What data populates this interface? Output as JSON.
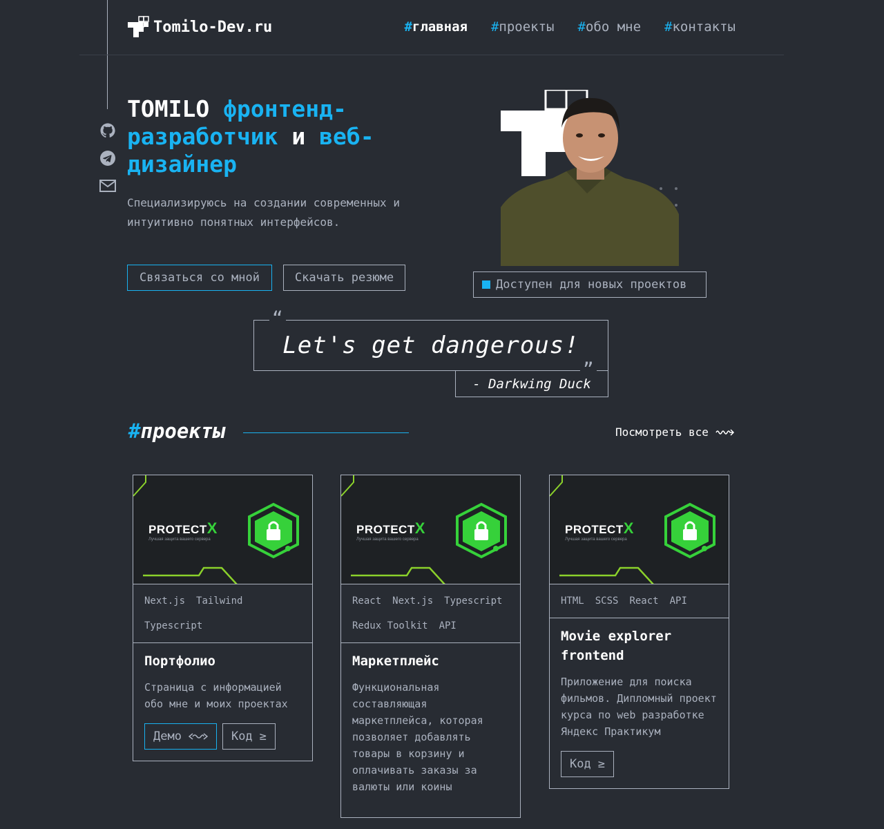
{
  "header": {
    "logo_text": "Tomilo-Dev.ru",
    "nav": [
      {
        "hash": "#",
        "label": "главная",
        "active": true
      },
      {
        "hash": "#",
        "label": "проекты",
        "active": false
      },
      {
        "hash": "#",
        "label": "обо мне",
        "active": false
      },
      {
        "hash": "#",
        "label": "контакты",
        "active": false
      }
    ]
  },
  "social": [
    "github-icon",
    "telegram-icon",
    "mail-icon"
  ],
  "hero": {
    "title_name": "TOMILO",
    "title_role1": "фронтенд-разработчик",
    "title_and": "и",
    "title_role2": "веб-дизайнер",
    "description": "Специализируюсь на создании современных и интуитивно понятных интерфейсов.",
    "contact_button": "Связаться со мной",
    "resume_button": "Скачать резюме",
    "status": "Доступен для новых проектов"
  },
  "quote": {
    "open_mark": "“",
    "close_mark": "”",
    "text": "Let's get dangerous!",
    "author": "- Darkwing Duck"
  },
  "projects": {
    "hash": "#",
    "title": "проекты",
    "view_all": "Посмотреть все",
    "items": [
      {
        "brand": "PROTECT",
        "brand_x": "X",
        "brand_sub": "Лучшая защита вашего сервера",
        "tags": [
          "Next.js",
          "Tailwind",
          "Typescript"
        ],
        "name": "Портфолио",
        "description": "Страница с информацией обо мне и моих проектах",
        "demo_label": "Демо",
        "code_label": "Код"
      },
      {
        "brand": "PROTECT",
        "brand_x": "X",
        "brand_sub": "Лучшая защита вашего сервера",
        "tags": [
          "React",
          "Next.js",
          "Typescript",
          "Redux Toolkit",
          "API"
        ],
        "name": "Маркетплейс",
        "description": "Функциональная составляющая маркетплейса, которая позволяет добавлять товары в корзину и оплачивать заказы за валюты или коины"
      },
      {
        "brand": "PROTECT",
        "brand_x": "X",
        "brand_sub": "Лучшая защита вашего сервера",
        "tags": [
          "HTML",
          "SCSS",
          "React",
          "API"
        ],
        "name": "Movie explorer frontend",
        "description": "Приложение для поиска фильмов. Дипломный проект курса по web разработке Яндекс Практикум",
        "code_label": "Код"
      }
    ]
  },
  "colors": {
    "background": "#282c33",
    "accent": "#19b3f2",
    "text_gray": "#abb2bf",
    "brand_green": "#36d13a"
  }
}
